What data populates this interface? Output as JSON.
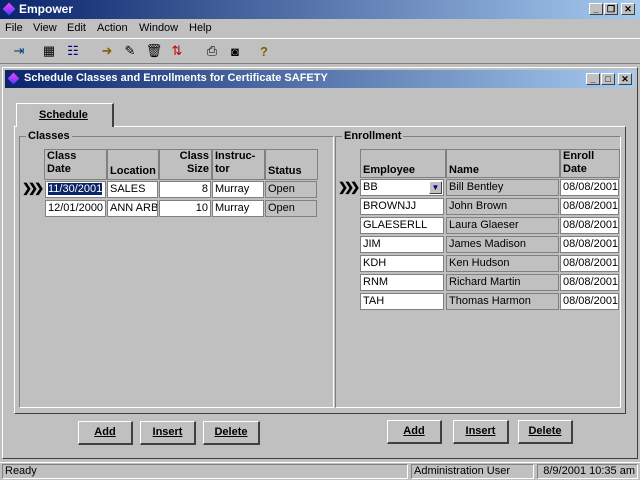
{
  "app": {
    "title": "Empower"
  },
  "menu": [
    "File",
    "View",
    "Edit",
    "Action",
    "Window",
    "Help"
  ],
  "toolbar": {
    "icons": [
      "exit-icon",
      "grid-icon",
      "tree-icon",
      "run-icon",
      "eraser-icon",
      "trash-icon",
      "sort-icon",
      "print-icon",
      "camera-icon",
      "help-icon"
    ]
  },
  "child": {
    "title": "Schedule Classes and Enrollments for Certificate SAFETY"
  },
  "tab": {
    "label": "Schedule"
  },
  "classes": {
    "group_label": "Classes",
    "headers": {
      "date": "Class\nDate",
      "location": "Location",
      "size": "Class\nSize",
      "instructor": "Instruc-\ntor",
      "status": "Status"
    },
    "rows": [
      {
        "date": "11/30/2001",
        "location": "SALES",
        "size": "8",
        "instructor": "Murray",
        "status": "Open"
      },
      {
        "date": "12/01/2000",
        "location": "ANN ARBO",
        "size": "10",
        "instructor": "Murray",
        "status": "Open"
      }
    ],
    "buttons": {
      "add": "Add",
      "insert": "Insert",
      "delete": "Delete"
    }
  },
  "enrollment": {
    "group_label": "Enrollment",
    "headers": {
      "employee": "Employee",
      "name": "Name",
      "date": "Enroll\nDate"
    },
    "rows": [
      {
        "employee": "BB",
        "name": "Bill Bentley",
        "date": "08/08/2001"
      },
      {
        "employee": "BROWNJJ",
        "name": "John Brown",
        "date": "08/08/2001"
      },
      {
        "employee": "GLAESERLL",
        "name": "Laura Glaeser",
        "date": "08/08/2001"
      },
      {
        "employee": "JIM",
        "name": "James Madison",
        "date": "08/08/2001"
      },
      {
        "employee": "KDH",
        "name": "Ken Hudson",
        "date": "08/08/2001"
      },
      {
        "employee": "RNM",
        "name": "Richard Martin",
        "date": "08/08/2001"
      },
      {
        "employee": "TAH",
        "name": "Thomas Harmon",
        "date": "08/08/2001"
      }
    ],
    "buttons": {
      "add": "Add",
      "insert": "Insert",
      "delete": "Delete"
    }
  },
  "status": {
    "left": "Ready",
    "user": "Administration User",
    "datetime": "8/9/2001 10:35 am"
  },
  "colors": {
    "titlebar_start": "#0a246a",
    "titlebar_end": "#a6caf0",
    "selection": "#0a246a"
  }
}
